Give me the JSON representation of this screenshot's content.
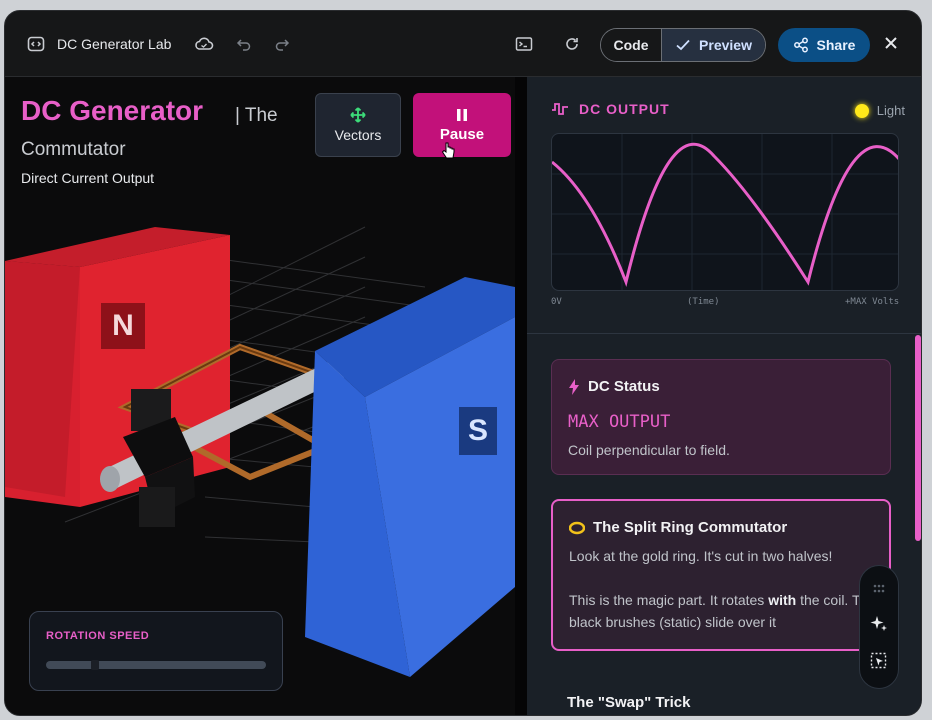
{
  "header": {
    "app_title": "DC Generator Lab",
    "code_label": "Code",
    "preview_label": "Preview",
    "share_label": "Share"
  },
  "scene": {
    "title": "DC Generator",
    "title_suffix": "| The",
    "title_line2": "Commutator",
    "subtitle": "Direct Current Output",
    "vectors_label": "Vectors",
    "pause_label": "Pause",
    "north_label": "N",
    "south_label": "S",
    "speed_label": "ROTATION SPEED",
    "speed_value_fraction": 0.21
  },
  "output": {
    "heading": "DC OUTPUT",
    "light_label": "Light",
    "axis_left": "0V",
    "axis_mid": "(Time)",
    "axis_right": "+MAX Volts"
  },
  "status_card": {
    "title": "DC Status",
    "state": "MAX OUTPUT",
    "detail": "Coil perpendicular to field."
  },
  "commutator_card": {
    "title": "The Split Ring Commutator",
    "para1": "Look at the gold ring. It's cut in two halves!",
    "para2_a": "This is the magic part. It rotates ",
    "para2_bold": "with",
    "para2_b": " the coil. The black brushes (static) slide over it"
  },
  "next_heading": "The \"Swap\" Trick",
  "colors": {
    "accent": "#e85fc8",
    "pause": "#c2117a",
    "share": "#0b4f86",
    "magnet_north": "#d8202f",
    "magnet_south": "#2f63d6",
    "light": "#ffe81a"
  }
}
